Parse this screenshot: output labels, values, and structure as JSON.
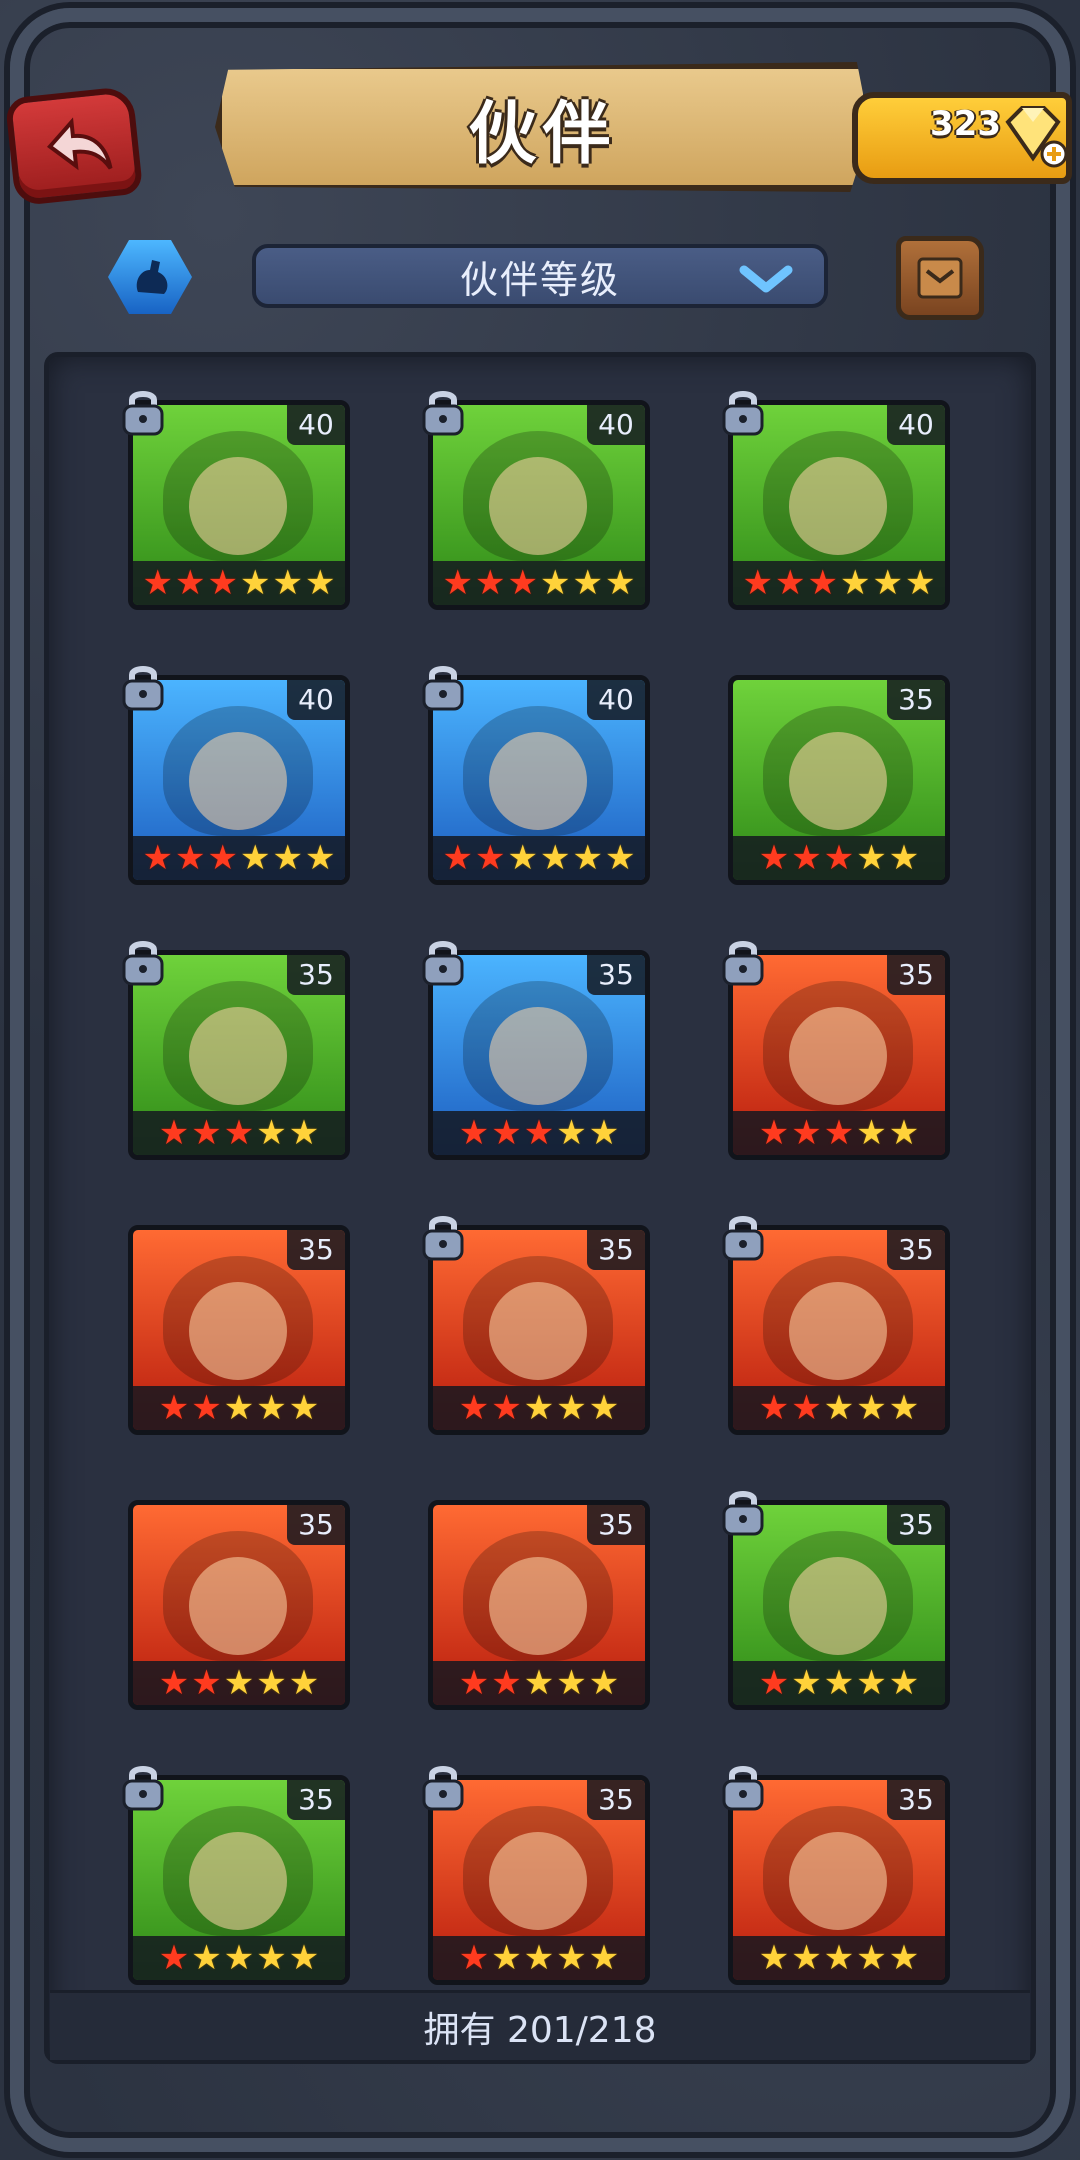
{
  "header": {
    "title": "伙伴",
    "back_icon": "back-arrow-icon",
    "gems": "323",
    "gem_icon": "gem-plus-icon"
  },
  "filter": {
    "icon": "sort-icon",
    "dropdown_label": "伙伴等级",
    "dropdown_icon": "chevron-down-icon",
    "scroll_icon": "scroll-icon"
  },
  "companions": [
    {
      "level": "40",
      "color": "green",
      "red_stars": 3,
      "total_stars": 6
    },
    {
      "level": "40",
      "color": "green",
      "red_stars": 3,
      "total_stars": 6
    },
    {
      "level": "40",
      "color": "green",
      "red_stars": 3,
      "total_stars": 6
    },
    {
      "level": "40",
      "color": "blue",
      "red_stars": 3,
      "total_stars": 6
    },
    {
      "level": "40",
      "color": "blue",
      "red_stars": 2,
      "total_stars": 6
    },
    {
      "level": "35",
      "color": "green",
      "red_stars": 3,
      "total_stars": 5
    },
    {
      "level": "35",
      "color": "green",
      "red_stars": 3,
      "total_stars": 5
    },
    {
      "level": "35",
      "color": "blue",
      "red_stars": 3,
      "total_stars": 5
    },
    {
      "level": "35",
      "color": "red",
      "red_stars": 3,
      "total_stars": 5
    },
    {
      "level": "35",
      "color": "red",
      "red_stars": 2,
      "total_stars": 5
    },
    {
      "level": "35",
      "color": "red",
      "red_stars": 2,
      "total_stars": 5
    },
    {
      "level": "35",
      "color": "red",
      "red_stars": 2,
      "total_stars": 5
    },
    {
      "level": "35",
      "color": "red",
      "red_stars": 2,
      "total_stars": 5
    },
    {
      "level": "35",
      "color": "red",
      "red_stars": 2,
      "total_stars": 5
    },
    {
      "level": "35",
      "color": "green",
      "red_stars": 1,
      "total_stars": 5
    },
    {
      "level": "35",
      "color": "green",
      "red_stars": 1,
      "total_stars": 5
    },
    {
      "level": "35",
      "color": "red",
      "red_stars": 1,
      "total_stars": 5
    },
    {
      "level": "35",
      "color": "red",
      "red_stars": 0,
      "total_stars": 5
    }
  ],
  "locked_cards": [
    0,
    1,
    2,
    3,
    4,
    6,
    7,
    8,
    10,
    11,
    14,
    15,
    16,
    17
  ],
  "footer": {
    "owned_text": "拥有 201/218"
  }
}
